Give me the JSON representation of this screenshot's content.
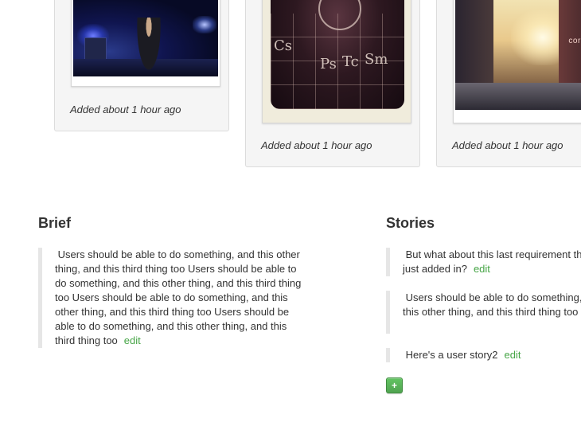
{
  "photos": [
    {
      "caption": "Added about 1 hour ago"
    },
    {
      "caption": "Added about 1 hour ago",
      "wall_symbols": [
        "Cs",
        "Ps",
        "Tc",
        "Sm"
      ]
    },
    {
      "caption": "Added about 1 hour ago",
      "sign_text": "corepo"
    }
  ],
  "brief": {
    "title": "Brief",
    "text": " Users should be able to do something, and this other thing, and this third thing too Users should be able to do something, and this other thing, and this third thing too Users should be able to do something, and this other thing, and this third thing too Users should be able to do something, and this other thing, and this third thing too",
    "edit_label": "edit"
  },
  "stories": {
    "title": "Stories",
    "items": [
      {
        "text": " But what about this last requirement that I just added in?",
        "edit_label": "edit"
      },
      {
        "text": " Users should be able to do something, and this other thing, and this third thing too",
        "edit_label": "edit"
      },
      {
        "text": " Here's a user story2",
        "edit_label": "edit"
      }
    ],
    "add_label": "+"
  },
  "colors": {
    "link_green": "#46a546",
    "button_green": "#5bb75b",
    "card_bg": "#f5f5f5"
  }
}
